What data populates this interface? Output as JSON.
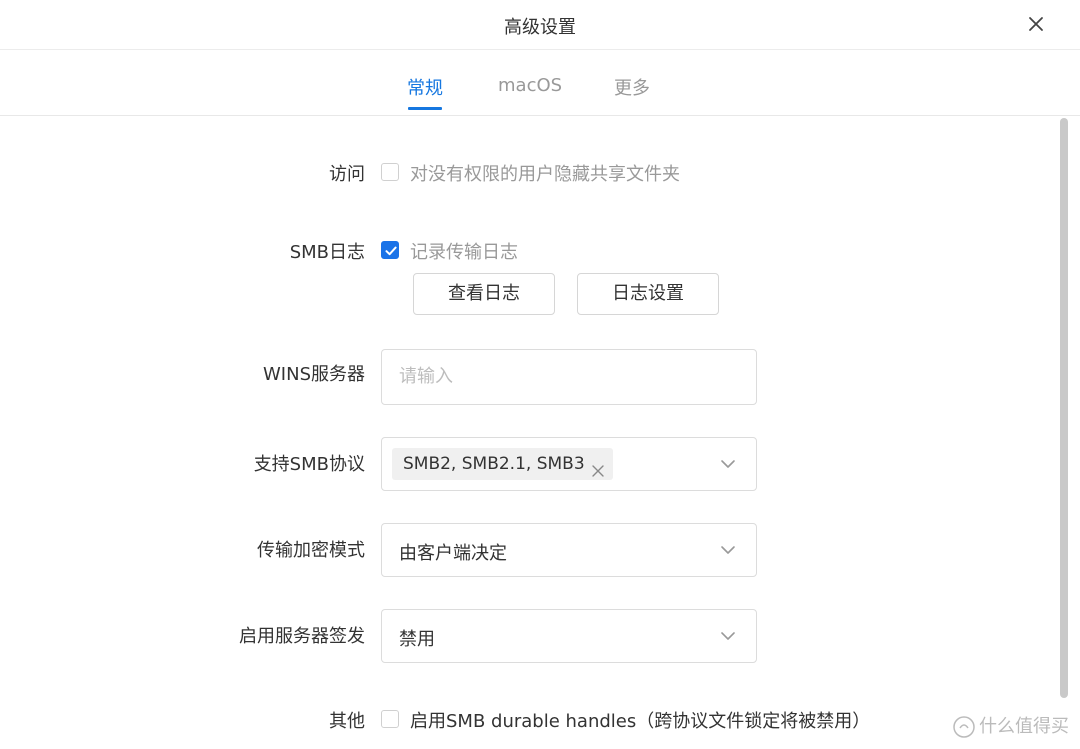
{
  "dialog": {
    "title": "高级设置"
  },
  "tabs": [
    {
      "label": "常规",
      "active": true
    },
    {
      "label": "macOS",
      "active": false
    },
    {
      "label": "更多",
      "active": false
    }
  ],
  "access": {
    "label": "访问",
    "checkbox_label": "对没有权限的用户隐藏共享文件夹",
    "checked": false
  },
  "smb_log": {
    "label": "SMB日志",
    "checkbox_label": "记录传输日志",
    "checked": true,
    "view_button": "查看日志",
    "settings_button": "日志设置"
  },
  "wins": {
    "label": "WINS服务器",
    "value": "",
    "placeholder": "请输入"
  },
  "smb_protocol": {
    "label": "支持SMB协议",
    "tag": "SMB2, SMB2.1, SMB3"
  },
  "encryption": {
    "label": "传输加密模式",
    "value": "由客户端决定"
  },
  "server_signing": {
    "label": "启用服务器签发",
    "value": "禁用"
  },
  "other": {
    "label": "其他",
    "checkbox_label": "启用SMB durable handles（跨协议文件锁定将被禁用）",
    "checked": false
  },
  "watermark": {
    "text": "什么值得买"
  },
  "colors": {
    "accent": "#1677e0",
    "checkbox_checked": "#1a73e8"
  }
}
